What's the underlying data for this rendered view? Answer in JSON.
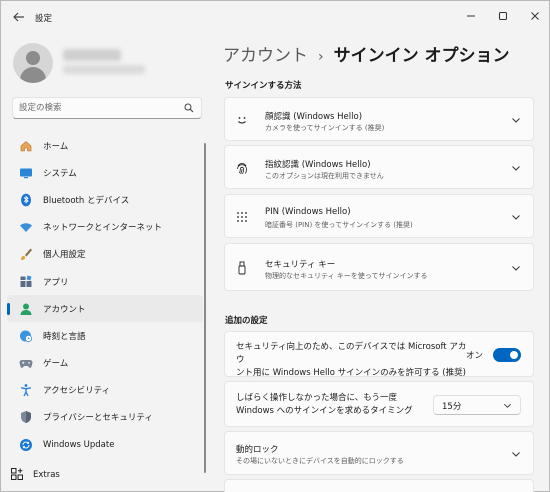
{
  "window": {
    "title": "設定"
  },
  "search": {
    "placeholder": "設定の検索"
  },
  "sidebar": {
    "items": [
      {
        "label": "ホーム",
        "icon": "home-icon",
        "active": false
      },
      {
        "label": "システム",
        "icon": "monitor-icon",
        "active": false
      },
      {
        "label": "Bluetooth とデバイス",
        "icon": "bluetooth-icon",
        "active": false
      },
      {
        "label": "ネットワークとインターネット",
        "icon": "wifi-icon",
        "active": false
      },
      {
        "label": "個人用設定",
        "icon": "brush-icon",
        "active": false
      },
      {
        "label": "アプリ",
        "icon": "apps-icon",
        "active": false
      },
      {
        "label": "アカウント",
        "icon": "account-icon",
        "active": true
      },
      {
        "label": "時刻と言語",
        "icon": "globe-clock-icon",
        "active": false
      },
      {
        "label": "ゲーム",
        "icon": "gamepad-icon",
        "active": false
      },
      {
        "label": "アクセシビリティ",
        "icon": "accessibility-icon",
        "active": false
      },
      {
        "label": "プライバシーとセキュリティ",
        "icon": "shield-icon",
        "active": false
      },
      {
        "label": "Windows Update",
        "icon": "update-icon",
        "active": false
      }
    ],
    "extras_label": "Extras"
  },
  "breadcrumb": {
    "parent": "アカウント",
    "separator": "›",
    "current": "サインイン オプション"
  },
  "sections": {
    "signin_methods_title": "サインインする方法",
    "additional_title": "追加の設定"
  },
  "methods": [
    {
      "title": "顔認識 (Windows Hello)",
      "subtitle": "カメラを使ってサインインする (推奨)",
      "icon": "smiley-face-icon"
    },
    {
      "title": "指紋認識 (Windows Hello)",
      "subtitle": "このオプションは現在利用できません",
      "icon": "fingerprint-icon"
    },
    {
      "title": "PIN (Windows Hello)",
      "subtitle": "暗証番号 (PIN) を使ってサインインする (推奨)",
      "icon": "keypad-icon"
    },
    {
      "title": "セキュリティ キー",
      "subtitle": "物理的なセキュリティ キーを使ってサインインする",
      "icon": "usb-key-icon"
    }
  ],
  "additional": {
    "hello_only": {
      "text_line1": "セキュリティ向上のため、このデバイスでは Microsoft アカウ",
      "text_line2": "ント用に Windows Hello サインインのみを許可する (推奨)",
      "toggle_label": "オン",
      "toggle_on": true
    },
    "require_signin": {
      "text_line1": "しばらく操作しなかった場合に、もう一度",
      "text_line2": "Windows へのサインインを求めるタイミング",
      "dropdown_value": "15分"
    },
    "dynamic_lock": {
      "title": "動的ロック",
      "subtitle": "その場にいないときにデバイスを自動的にロックする"
    }
  },
  "colors": {
    "accent": "#0067c0",
    "background": "#f3f3f3",
    "card": "#fbfbfb"
  }
}
